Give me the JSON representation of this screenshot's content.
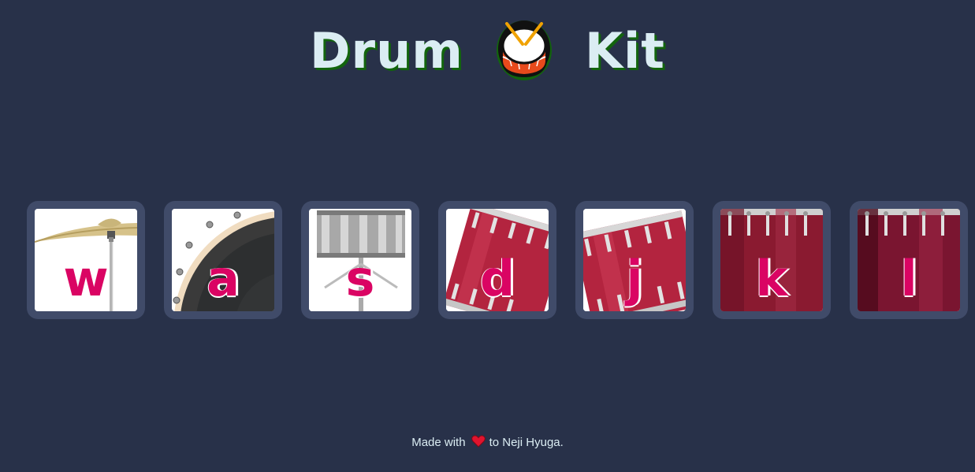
{
  "header": {
    "title_left": "Drum",
    "title_right": "Kit",
    "title_icon": "drum-emoji-icon"
  },
  "keys": [
    {
      "letter": "w",
      "sound": "crash-cymbal"
    },
    {
      "letter": "a",
      "sound": "kick-bass"
    },
    {
      "letter": "s",
      "sound": "snare"
    },
    {
      "letter": "d",
      "sound": "tom-1"
    },
    {
      "letter": "j",
      "sound": "tom-2"
    },
    {
      "letter": "k",
      "sound": "tom-3"
    },
    {
      "letter": "l",
      "sound": "tom-4"
    }
  ],
  "footer": {
    "before": "Made with",
    "icon": "heart-icon",
    "after": "to Neji Hyuga."
  },
  "colors": {
    "background": "#283149",
    "key_frame": "#404b69",
    "letter": "#da0463",
    "title": "#dbedf3",
    "title_shadow": "#12640d"
  }
}
